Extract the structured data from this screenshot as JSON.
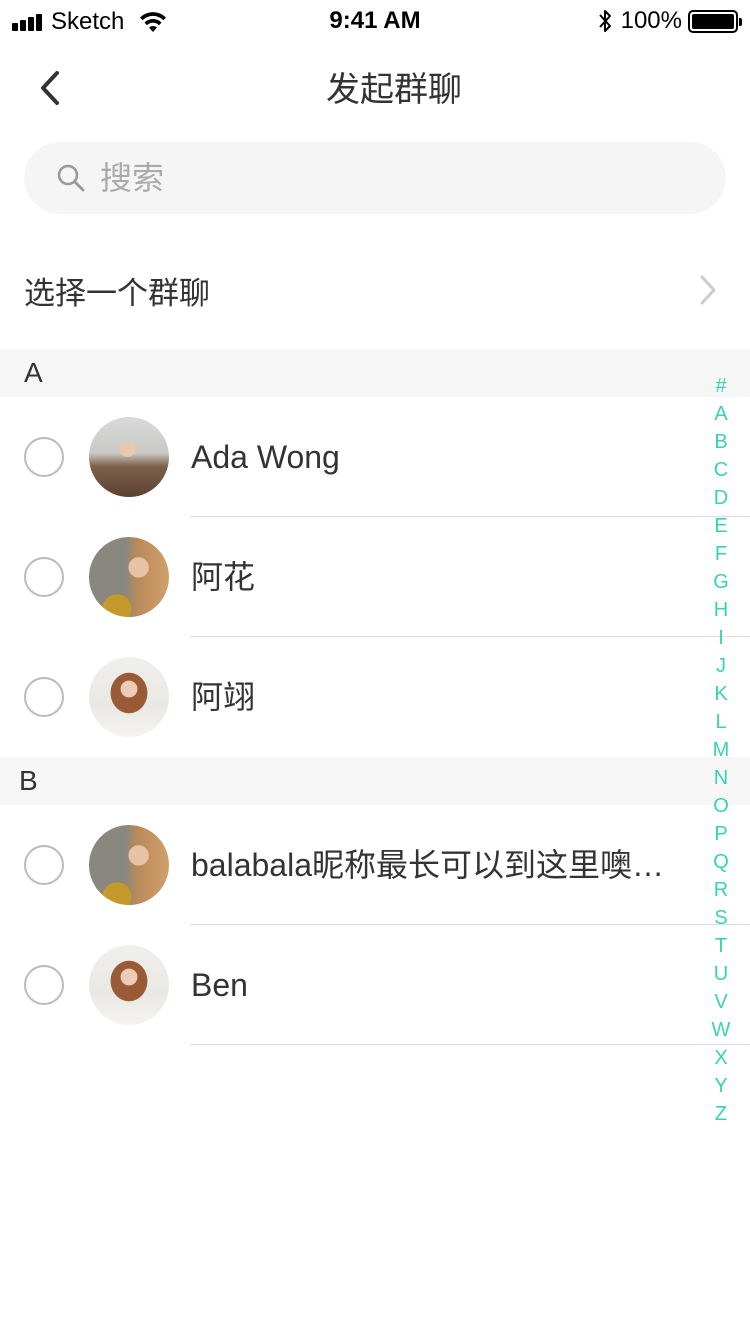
{
  "status_bar": {
    "carrier": "Sketch",
    "time": "9:41 AM",
    "battery_percent": "100%"
  },
  "nav": {
    "title": "发起群聊"
  },
  "search": {
    "placeholder": "搜索"
  },
  "choose_group": {
    "label": "选择一个群聊"
  },
  "sections": [
    {
      "letter": "A",
      "contacts": [
        {
          "name": "Ada Wong",
          "selected": false
        },
        {
          "name": "阿花",
          "selected": false
        },
        {
          "name": "阿翊",
          "selected": false
        }
      ]
    },
    {
      "letter": "B",
      "contacts": [
        {
          "name": "balabala昵称最长可以到这里噢…",
          "selected": false
        },
        {
          "name": "Ben",
          "selected": false
        }
      ]
    }
  ],
  "index_letters": [
    "#",
    "A",
    "B",
    "C",
    "D",
    "E",
    "F",
    "G",
    "H",
    "I",
    "J",
    "K",
    "L",
    "M",
    "N",
    "O",
    "P",
    "Q",
    "R",
    "S",
    "T",
    "U",
    "V",
    "W",
    "X",
    "Y",
    "Z"
  ],
  "colors": {
    "index_accent": "#3ad2b4",
    "section_background": "#f6f6f6",
    "search_background": "#f5f5f5"
  },
  "icons": {
    "back": "chevron-left-icon",
    "search": "search-icon",
    "choose_group": "chevron-right-icon",
    "wifi": "wifi-icon",
    "bluetooth": "bluetooth-icon",
    "battery": "battery-icon",
    "signal": "signal-icon"
  }
}
